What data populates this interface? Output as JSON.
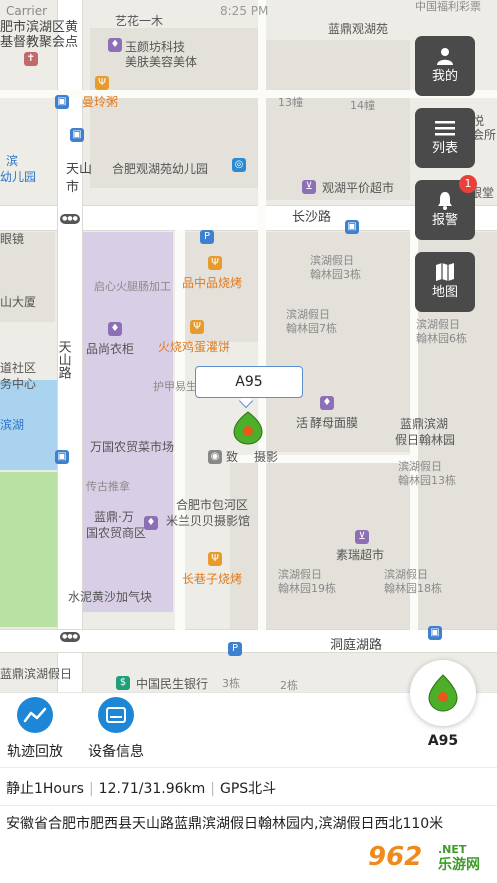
{
  "status_bar": {
    "carrier": "Carrier",
    "time": "8:25 PM"
  },
  "map": {
    "labels": {
      "top_left_1": "肥市滨湖区黄",
      "top_left_2": "基督教聚会点",
      "yiyun": "艺花一木",
      "binhu_top": "蓝鼎观湖苑",
      "fuxin": "中国福利彩票",
      "yuyan": "玉颜坊科技",
      "meifu": "美肤美容美体",
      "manling": "曼玲粥",
      "b13": "13幢",
      "b14": "14幢",
      "meipin": "美品尖荣悦",
      "meixing": "美容养生会所",
      "tianshan": "天山",
      "shi": "市",
      "kindergarten": "合肥观湖苑幼儿园",
      "hanzi_left": "滨",
      "youer": "幼儿园",
      "guanhu": "观湖平价超市",
      "yinzhi": "银堂",
      "changsha": "长沙路",
      "yanjing": "眼镜",
      "qixin": "启心火腿肠加工",
      "pinzhong": "品中品烧烤",
      "binhu_hanlin3": "滨湖假日",
      "hanlin3": "翰林园3栋",
      "dasha": "山大厦",
      "binhu_hanlin7": "滨湖假日",
      "hanlin7": "翰林园7栋",
      "binhu_hanlin6": "滨湖假日",
      "hanlin6": "翰林园6栋",
      "pinshang": "品尚衣柜",
      "tianshanlu": "天山路",
      "huoshao": "火烧鸡蛋灌饼",
      "daoshequ": "道社区",
      "wuzhongxin": "务中心",
      "hujia": "护甲易生",
      "hu": "滨湖",
      "jiaoyun": "酵母面膜",
      "huo": "活",
      "landing": "蓝鼎滨湖",
      "jiari_hanlin": "假日翰林园",
      "wanguo": "万国农贸菜市场",
      "zhi": "致",
      "sheying": "摄影",
      "binhu_linyuan": "滨湖假日",
      "hanlin13": "翰林园13栋",
      "chuanqi": "传古推拿",
      "baohe": "合肥市包河区",
      "milan": "米兰贝贝摄影馆",
      "landing_wan": "蓝鼎·万",
      "guonong": "国农贸商区",
      "surui": "素瑞超市",
      "changxiang": "长巷子烧烤",
      "binhu_hanlin19": "滨湖假日",
      "hanlin19": "翰林园19栋",
      "binhu_hanlin18": "滨湖假日",
      "hanlin18": "翰林园18栋",
      "shuini": "水泥黄沙加气块",
      "dongting": "洞庭湖路",
      "binhu_jiari_bottom": "蓝鼎滨湖假日",
      "minsheng": "中国民生银行",
      "b3": "3栋",
      "b2": "2栋"
    },
    "controls": [
      {
        "id": "mine",
        "label": "我的",
        "icon": "person-icon"
      },
      {
        "id": "list",
        "label": "列表",
        "icon": "list-icon"
      },
      {
        "id": "alarm",
        "label": "报警",
        "icon": "bell-icon"
      },
      {
        "id": "map",
        "label": "地图",
        "icon": "map-icon"
      }
    ],
    "alarm_count": "1",
    "vehicle_marker": {
      "callout": "A95"
    }
  },
  "panel": {
    "actions": [
      {
        "label": "轨迹回放",
        "icon": "track-playback-icon"
      },
      {
        "label": "设备信息",
        "icon": "device-info-icon"
      }
    ],
    "vehicle_name": "A95",
    "stats": {
      "state": "静止1Hours",
      "mileage": "12.71/31.96km",
      "positioning": "GPS北斗"
    },
    "address": "安徽省合肥市肥西县天山路蓝鼎滨湖假日翰林园内,滨湖假日西北110米"
  },
  "watermark": {
    "main": "962",
    "domain": ".NET",
    "site": "乐游网"
  },
  "colors": {
    "accent": "#1d86d6",
    "marker_green": "#4caf2a",
    "marker_orange": "#e8571b",
    "badge": "#e8413b",
    "control_bg": "#4a4a4a"
  }
}
